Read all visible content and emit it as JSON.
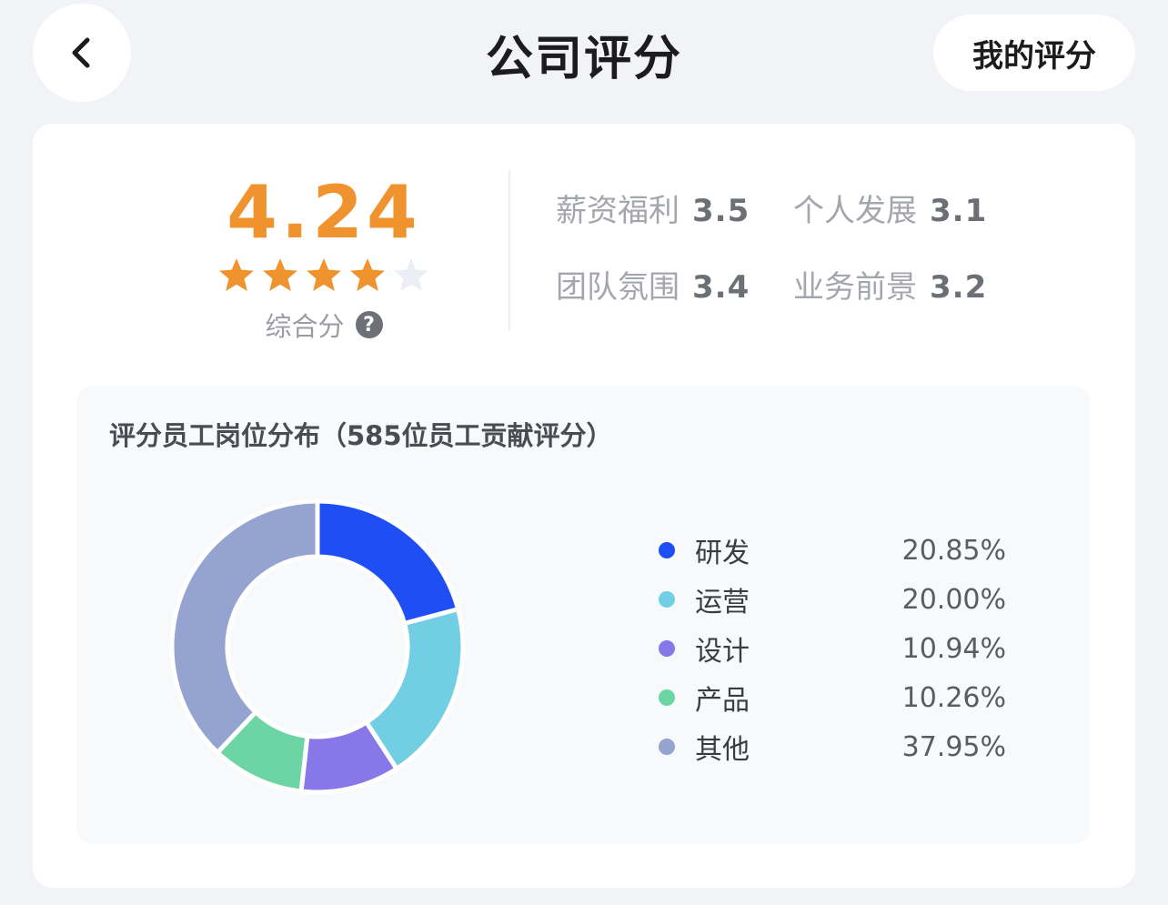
{
  "header": {
    "title": "公司评分",
    "my_rating_label": "我的评分"
  },
  "overall": {
    "score": "4.24",
    "stars_filled": 4,
    "stars_total": 5,
    "label": "综合分",
    "help_glyph": "?"
  },
  "sub_scores": [
    {
      "name": "薪资福利",
      "value": "3.5"
    },
    {
      "name": "个人发展",
      "value": "3.1"
    },
    {
      "name": "团队氛围",
      "value": "3.4"
    },
    {
      "name": "业务前景",
      "value": "3.2"
    }
  ],
  "colors": {
    "accent": "#f0922e",
    "star_empty": "#eceef6"
  },
  "distribution": {
    "title": "评分员工岗位分布（585位员工贡献评分）"
  },
  "chart_data": {
    "type": "pie",
    "title": "评分员工岗位分布（585位员工贡献评分）",
    "categories": [
      "研发",
      "运营",
      "设计",
      "产品",
      "其他"
    ],
    "values": [
      20.85,
      20.0,
      10.94,
      10.26,
      37.95
    ],
    "labels": [
      "20.85%",
      "20.00%",
      "10.94%",
      "10.26%",
      "37.95%"
    ],
    "colors": [
      "#1f4ef5",
      "#72cfe3",
      "#8877e8",
      "#6dd5a4",
      "#94a3cf"
    ],
    "legend": "right"
  }
}
